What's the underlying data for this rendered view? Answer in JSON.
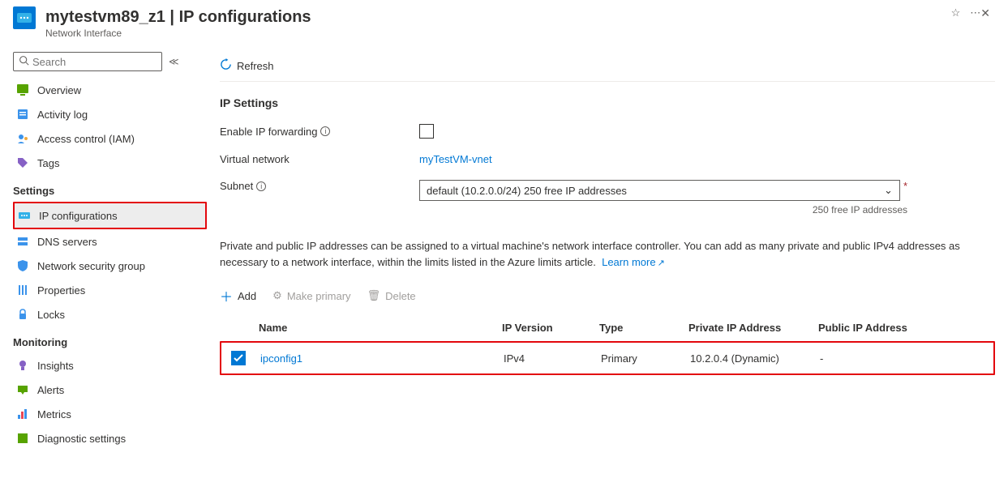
{
  "header": {
    "title": "mytestvm89_z1 | IP configurations",
    "subtitle": "Network Interface"
  },
  "sidebar": {
    "search_placeholder": "Search",
    "items_top": [
      {
        "label": "Overview"
      },
      {
        "label": "Activity log"
      },
      {
        "label": "Access control (IAM)"
      },
      {
        "label": "Tags"
      }
    ],
    "group_settings_label": "Settings",
    "items_settings": [
      {
        "label": "IP configurations"
      },
      {
        "label": "DNS servers"
      },
      {
        "label": "Network security group"
      },
      {
        "label": "Properties"
      },
      {
        "label": "Locks"
      }
    ],
    "group_monitoring_label": "Monitoring",
    "items_monitoring": [
      {
        "label": "Insights"
      },
      {
        "label": "Alerts"
      },
      {
        "label": "Metrics"
      },
      {
        "label": "Diagnostic settings"
      }
    ]
  },
  "main": {
    "refresh_label": "Refresh",
    "section_title": "IP Settings",
    "ip_forwarding_label": "Enable IP forwarding",
    "vnet_label": "Virtual network",
    "vnet_value": "myTestVM-vnet",
    "subnet_label": "Subnet",
    "subnet_value": "default (10.2.0.0/24) 250 free IP addresses",
    "subnet_hint": "250 free IP addresses",
    "description_text": "Private and public IP addresses can be assigned to a virtual machine's network interface controller. You can add as many private and public IPv4 addresses as necessary to a network interface, within the limits listed in the Azure limits article.",
    "learn_more": "Learn more",
    "tbl_toolbar": {
      "add": "Add",
      "make_primary": "Make primary",
      "delete": "Delete"
    },
    "columns": {
      "name": "Name",
      "ip_version": "IP Version",
      "type": "Type",
      "private_ip": "Private IP Address",
      "public_ip": "Public IP Address"
    },
    "rows": [
      {
        "name": "ipconfig1",
        "ip_version": "IPv4",
        "type": "Primary",
        "private_ip": "10.2.0.4 (Dynamic)",
        "public_ip": "-"
      }
    ]
  }
}
